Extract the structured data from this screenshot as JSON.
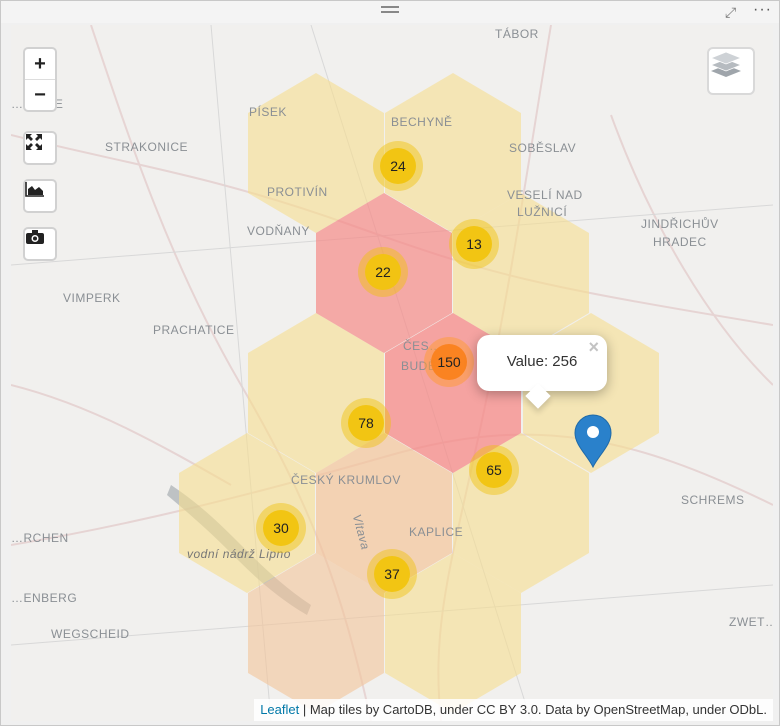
{
  "map": {
    "zoom_in_label": "+",
    "zoom_out_label": "−",
    "popup": {
      "text": "Value: 256",
      "close": "×"
    },
    "attribution": {
      "link": "Leaflet",
      "text": " | Map tiles by CartoDB, under CC BY 3.0. Data by OpenStreetMap, under ODbL."
    },
    "places": [
      "TÁBOR",
      "…OVICE",
      "PÍSEK",
      "BECHYNĚ",
      "STRAKONICE",
      "SOBĚSLAV",
      "PROTIVÍN",
      "VESELÍ NAD",
      "LUŽNICÍ",
      "JINDŘICHŮV",
      "HRADEC",
      "VODŇANY",
      "VIMPERK",
      "PRACHATICE",
      "ČES…",
      "BUDĚ…",
      "ČESKÝ KRUMLOV",
      "SCHREMS",
      "KAPLICE",
      "…RCHEN",
      "Vltava",
      "vodní nádrž Lipno",
      "…ENBERG",
      "WEGSCHEID",
      "ZWET…"
    ],
    "clusters": [
      {
        "label": "24",
        "level": "low"
      },
      {
        "label": "13",
        "level": "low"
      },
      {
        "label": "22",
        "level": "low"
      },
      {
        "label": "150",
        "level": "high"
      },
      {
        "label": "78",
        "level": "low"
      },
      {
        "label": "65",
        "level": "low"
      },
      {
        "label": "30",
        "level": "low"
      },
      {
        "label": "37",
        "level": "low"
      }
    ],
    "colors": {
      "hex_pale": "#f7dd8f",
      "hex_peach": "#f4c49a",
      "hex_red": "#f58a87",
      "marker": "#2a81cb"
    }
  }
}
